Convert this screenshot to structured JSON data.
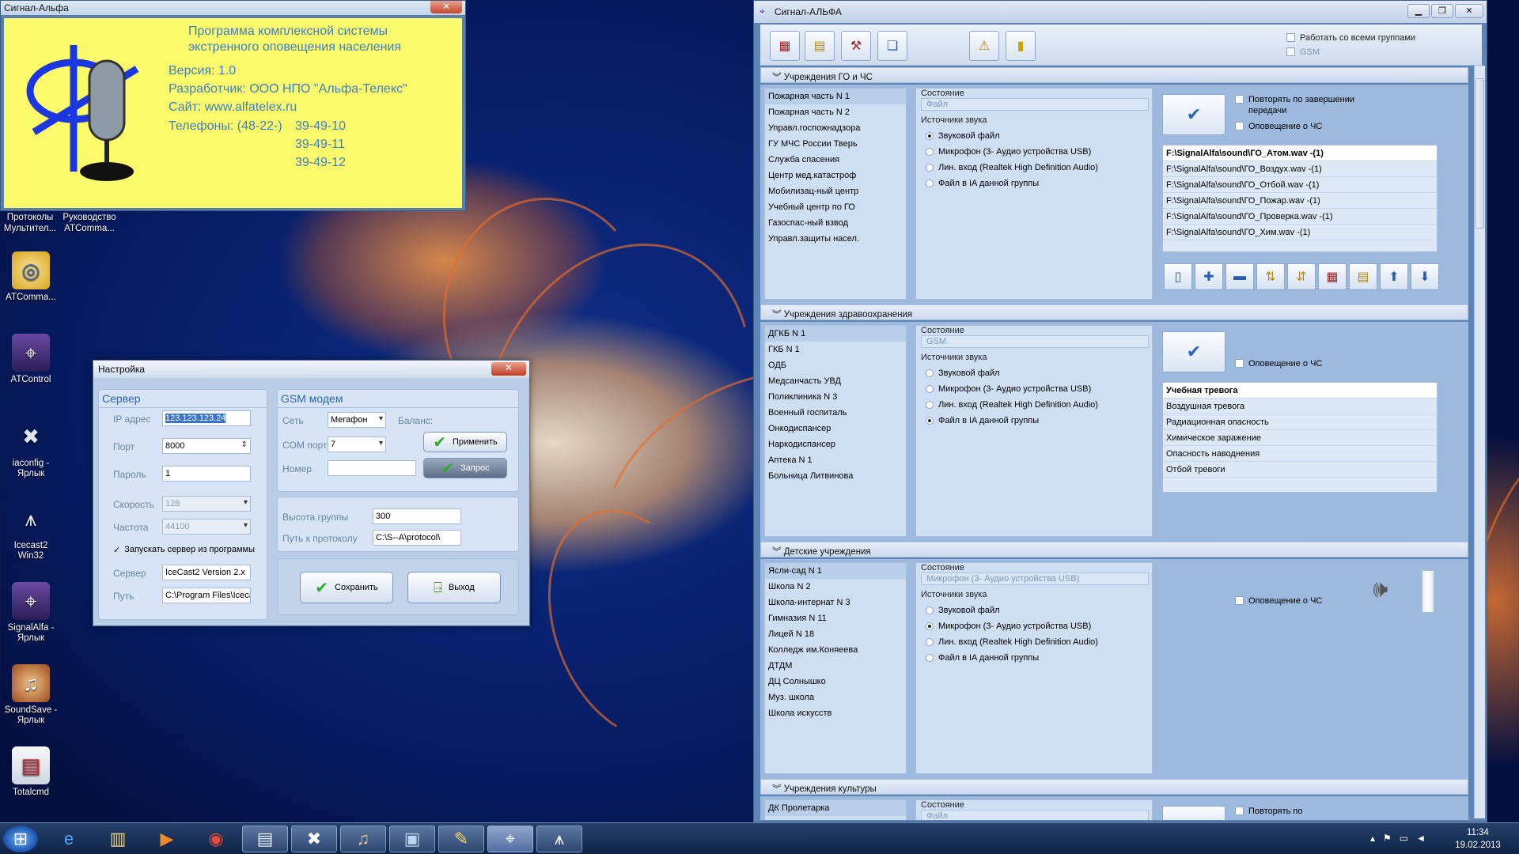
{
  "splash": {
    "title": "Сигнал-Альфа",
    "close": "✕",
    "line1": "Программа комплексной системы",
    "line2": "экстренного оповещения населения",
    "version": "Версия: 1.0",
    "developer": "Разработчик: ООО НПО \"Альфа-Телекс\"",
    "site": "Сайт: www.alfatelex.ru",
    "phones_label": "Телефоны: (48-22-)",
    "phones": [
      "39-49-10",
      "39-49-11",
      "39-49-12"
    ]
  },
  "desktop": {
    "top_labels": [
      "Протоколы Мультител...",
      "Руководство ATComma..."
    ],
    "icons": [
      {
        "name": "ATComma...",
        "icon": "globe-icon"
      },
      {
        "name": "ATControl",
        "icon": "satellite-icon"
      },
      {
        "name": "iaconfig - Ярлык",
        "icon": "tools-icon"
      },
      {
        "name": "Icecast2 Win32",
        "icon": "antenna-icon"
      },
      {
        "name": "SignalAlfa - Ярлык",
        "icon": "satellite-icon"
      },
      {
        "name": "SoundSave - Ярлык",
        "icon": "sound-icon"
      },
      {
        "name": "Totalcmd",
        "icon": "floppy-icon"
      }
    ]
  },
  "settings": {
    "title": "Настройка",
    "close": "✕",
    "server": {
      "title": "Сервер",
      "ip_label": "IP адрес",
      "ip": "123.123.123.24",
      "port_label": "Порт",
      "port": "8000",
      "password_label": "Пароль",
      "password": "1",
      "speed_label": "Скорость",
      "speed": "128",
      "freq_label": "Частота",
      "freq": "44100",
      "autostart": "Запускать сервер из программы",
      "server_label": "Сервер",
      "server": "IceCast2 Version 2.x",
      "path_label": "Путь",
      "path": "C:\\Program Files\\Iceca"
    },
    "gsm": {
      "title": "GSM модем",
      "net_label": "Сеть",
      "net": "Мегафон",
      "balance_label": "Баланс:",
      "com_label": "COM порт",
      "com": "7",
      "number_label": "Номер",
      "number": "",
      "apply": "Применить",
      "request": "Запрос"
    },
    "group_height_label": "Высота группы",
    "group_height": "300",
    "protocol_label": "Путь к протоколу",
    "protocol": "C:\\S--A\\protocol\\",
    "save": "Сохранить",
    "exit": "Выход"
  },
  "app": {
    "title": "Сигнал-АЛЬФА",
    "all_groups": "Работать со всеми группами",
    "gsm": "GSM",
    "sections": [
      {
        "title": "Учреждения ГО и ЧС",
        "items": [
          "Пожарная часть N 1",
          "Пожарная часть N 2",
          "Управл.госпожнадзора",
          "ГУ МЧС России Тверь",
          "Служба спасения",
          "Центр мед.катастроф",
          "Мобилизац-ный центр",
          "Учебный центр по ГО",
          "Газоспас-ный взвод",
          "Управл.защиты насел."
        ],
        "state_label": "Состояние",
        "state": "Файл",
        "sources_label": "Источники звука",
        "sources": [
          "Звуковой файл",
          "Микрофон (3- Аудио устройства USB)",
          "Лин. вход (Realtek High Definition Audio)",
          "Файл в IA данной группы"
        ],
        "repeat": "Повторять по завершении передачи",
        "notify": "Оповещение о ЧС",
        "files": [
          "F:\\SignalAlfa\\sound\\ГО_Атом.wav -(1)",
          "F:\\SignalAlfa\\sound\\ГО_Воздух.wav -(1)",
          "F:\\SignalAlfa\\sound\\ГО_Отбой.wav -(1)",
          "F:\\SignalAlfa\\sound\\ГО_Пожар.wav -(1)",
          "F:\\SignalAlfa\\sound\\ГО_Проверка.wav -(1)",
          "F:\\SignalAlfa\\sound\\ГО_Хим.wav -(1)"
        ]
      },
      {
        "title": "Учреждения здравоохранения",
        "items": [
          "ДГКБ N 1",
          "ГКБ N 1",
          "ОДБ",
          "Медсанчасть УВД",
          "Поликлиника N 3",
          "Военный госпиталь",
          "Онкодиспансер",
          "Наркодиспансер",
          "Аптека N 1",
          "Больница Литвинова"
        ],
        "state_label": "Состояние",
        "state": "GSM",
        "sources_label": "Источники звука",
        "sources": [
          "Звуковой файл",
          "Микрофон (3- Аудио устройства USB)",
          "Лин. вход (Realtek High Definition Audio)",
          "Файл в IA данной группы"
        ],
        "notify": "Оповещение о ЧС",
        "files": [
          "Учебная тревога",
          "Воздушная тревога",
          "Радиационная опасность",
          "Химическое заражение",
          "Опасность наводнения",
          "Отбой тревоги"
        ]
      },
      {
        "title": "Детские учреждения",
        "items": [
          "Ясли-сад N 1",
          "Школа N 2",
          "Школа-интернат N 3",
          "Гимназия N 11",
          "Лицей N 18",
          "Колледж им.Коняеева",
          "ДТДМ",
          "ДЦ Солнышко",
          "Муз. школа",
          "Школа искусств"
        ],
        "state_label": "Состояние",
        "state": "Микрофон (3- Аудио устройства USB)",
        "sources_label": "Источники звука",
        "sources": [
          "Звуковой файл",
          "Микрофон (3- Аудио устройства USB)",
          "Лин. вход (Realtek High Definition Audio)",
          "Файл в IA данной группы"
        ],
        "notify": "Оповещение о ЧС"
      },
      {
        "title": "Учреждения культуры",
        "items": [
          "ДК Пролетарка"
        ],
        "state_label": "Состояние",
        "state": "Файл",
        "repeat": "Повторять по"
      }
    ]
  },
  "taskbar": {
    "time": "11:34",
    "date": "19.02.2013"
  }
}
